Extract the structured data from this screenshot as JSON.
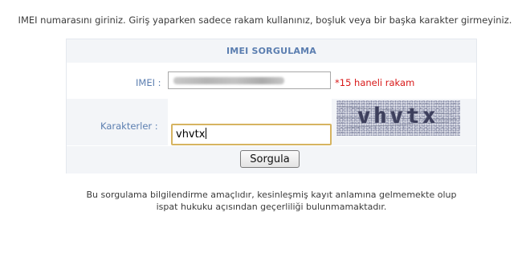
{
  "instruction": "IMEI numarasını giriniz. Giriş yaparken sadece rakam kullanınız, boşluk veya bir başka karakter girmeyiniz.",
  "panel": {
    "title": "IMEI SORGULAMA",
    "imei": {
      "label": "IMEI :",
      "value": "",
      "hint": "*15 haneli rakam"
    },
    "captcha": {
      "label": "Karakterler :",
      "image_text": "vhvtx",
      "input_value": "vhvtx"
    },
    "submit_label": "Sorgula"
  },
  "disclaimer": {
    "line1": "Bu sorgulama bilgilendirme amaçlıdır, kesinleşmiş kayıt anlamına gelmemekte olup",
    "line2": "ispat hukuku açısından geçerliliği bulunmamaktadır."
  },
  "colors": {
    "header_text": "#5b7eb0",
    "label_text": "#5b7eb0",
    "hint_text": "#d81818",
    "row_background": "#f3f5f8",
    "focus_border": "#d6b461"
  }
}
